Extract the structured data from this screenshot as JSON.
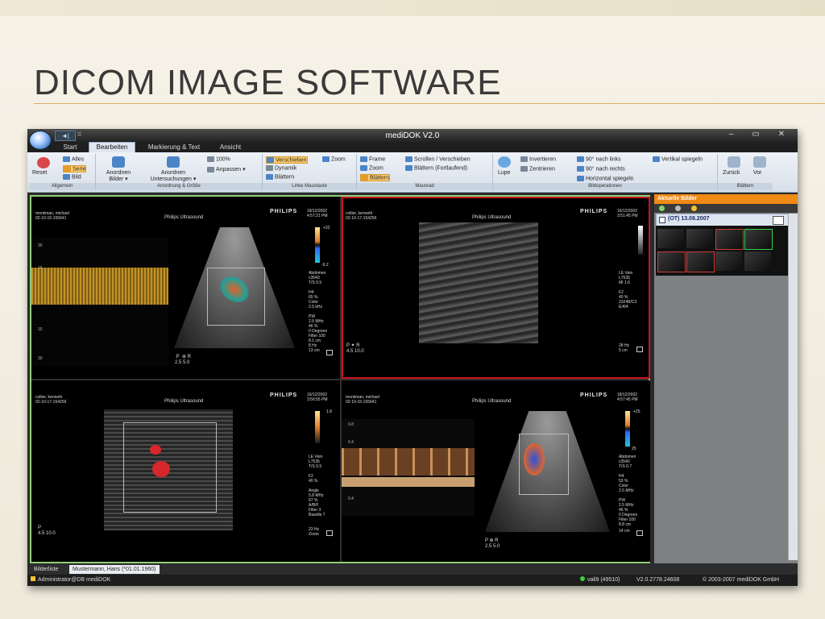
{
  "slide": {
    "title": "DICOM IMAGE SOFTWARE"
  },
  "window": {
    "title": "mediDOK V2.0",
    "qat_arrow": "◄|",
    "qat_eq": "=",
    "controls": "–  ▭  ✕"
  },
  "tabs": [
    "Start",
    "Bearbeiten",
    "Markierung & Text",
    "Ansicht"
  ],
  "ribbon": {
    "allgemein": {
      "label": "Allgemein",
      "reset": "Reset",
      "alles": "Alles",
      "serie": "Serie",
      "bild": "Bild"
    },
    "anordnung": {
      "label": "Anordnung & Größe",
      "anordnen_bilder": "Anordnen Bilder ▾",
      "anordnen_unters": "Anordnen Untersuchungen ▾",
      "zoom100": "100%",
      "anpassen": "Anpassen ▾"
    },
    "linke_maus": {
      "label": "Linke Maustaste",
      "verschieben": "Verschieben",
      "dynamik": "Dynamik",
      "blaettern": "Blättern",
      "zoom": "Zoom"
    },
    "mausrad": {
      "label": "Mausrad",
      "frame": "Frame",
      "zoom": "Zoom",
      "blaettern": "Blättern",
      "scrollen": "Scrollen / Verschieben",
      "blaettern_fort": "Blättern (Fortlaufend)"
    },
    "bildop": {
      "label": "Bildoperationen",
      "lupe": "Lupe",
      "invertieren": "Invertieren",
      "zentrieren": "Zentrieren",
      "links": "90° nach links",
      "rechts": "90° nach rechts",
      "horizontal": "Horizontal spiegeln",
      "vertikal": "Vertikal spiegeln"
    },
    "blaettern": {
      "label": "Blättern",
      "zurueck": "Zurück",
      "vor": "Vor"
    }
  },
  "panes": [
    {
      "hdr": "monkman, michael\n02-10-15-155641",
      "date": "18/12/2002\n4:57:21 PM",
      "brand": "PHILIPS",
      "ultra": "Philips Ultrasound",
      "side": "Abdomen\nc3540\nT/S 0.5\n\nH4\n65 %\nColor\n2.5 kHz\n\nPW\n2.5 MHz\n46 %\n0 Degrees\nFilter 100\n8.1 cm",
      "bottom": "8 Hz\n13 cm",
      "probe": " P  ⊕ R\n2.5 5.0",
      "cb_top": "+32",
      "cb_bot": "-9.2"
    },
    {
      "hdr": "collier, kenneth\n02-10-17-154256",
      "date": "16/12/2002\n3:51:45 PM",
      "brand": "PHILIPS",
      "ultra": "Philips Ultrasound",
      "side": "LE Vein\nL7535\nMI 1.6\n\nF2\n40 %\n2324B/C3\nE/4/4",
      "bottom": "28 Hz\n5 cm",
      "probe": "P ✦ R\n4.5 10.0"
    },
    {
      "hdr": "collier, kenneth\n02-10-17-154256",
      "date": "16/12/2002\n3:56:55 PM",
      "brand": "PHILIPS",
      "ultra": "Philips Ultrasound",
      "side": "LE Vein\nL7535\nT/S 0.5\n\nF2\n40 %\n\nAngle\n5.8 MHz\n67 %\nA/B/F\nFilter 3\nBaselle 7",
      "bottom": "23 Hz\nZoom",
      "probe": "P\n4.5 10.0",
      "cb_top": "1.8"
    },
    {
      "hdr": "monkman, michael\n02-10-15-155641",
      "date": "18/12/2002\n4:57:45 PM",
      "brand": "PHILIPS",
      "ultra": "Philips Ultrasound",
      "side": "Abdomen\nc3540\nT/S 0.7\n\nH4\n53 %\nColor\n2.5 MHz\n\nPW\n2.5 MHz\n46 %\n0 Degrees\nFilter 100\n8.8 cm",
      "bottom": "14 cm",
      "probe": "P ⊕ R\n2.5 5.0",
      "cb_top": "+25",
      "cb_bot": "25"
    }
  ],
  "doppler_scale": [
    "30",
    "15",
    "",
    "15",
    "30"
  ],
  "doppler_scale_b": [
    "0.8",
    "0.4",
    "",
    "0.4"
  ],
  "right_panel": {
    "header": "Aktuelle Bilder",
    "study": "(OT) 13.08.2007"
  },
  "bottom_tabs": [
    "Bilderliste",
    "Mustermann, Hans (*01.01.1960)"
  ],
  "status": {
    "user": "Administrator@DB mediDOK",
    "server": "vali9 (49510)",
    "version": "V2.0.2778.24608",
    "copyright": "© 2003-2007 mediDOK GmbH"
  }
}
